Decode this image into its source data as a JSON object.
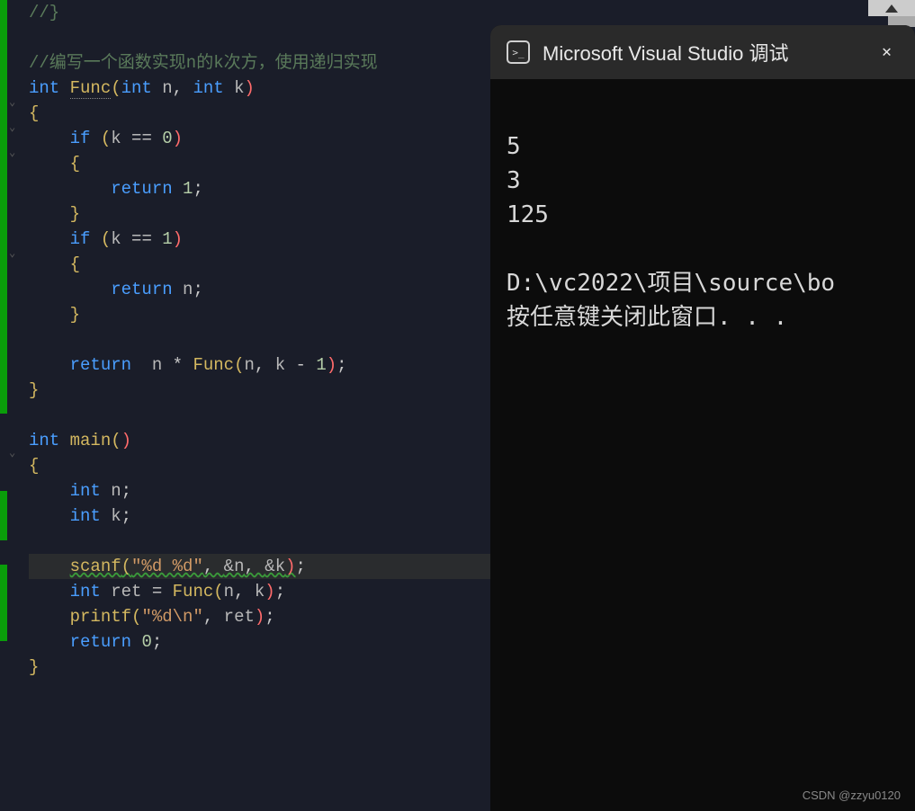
{
  "editor": {
    "lines": {
      "l0_brace": "//}",
      "comment": "//编写一个函数实现n的k次方，使用递归实现",
      "func_sig": {
        "kw_int": "int ",
        "name": "Func",
        "p1": "(",
        "arg1t": "int ",
        "arg1": "n",
        "comma1": ", ",
        "arg2t": "int ",
        "arg2": "k",
        "p2": ")"
      },
      "obrace": "{",
      "if_k0": {
        "kw": "if ",
        "p1": "(",
        "var": "k ",
        "op": "== ",
        "num": "0",
        "p2": ")"
      },
      "obrace2": "{",
      "ret1": {
        "kw": "return ",
        "num": "1",
        "semi": ";"
      },
      "cbrace2": "}",
      "if_k1": {
        "kw": "if ",
        "p1": "(",
        "var": "k ",
        "op": "== ",
        "num": "1",
        "p2": ")"
      },
      "obrace3": "{",
      "retn": {
        "kw": "return ",
        "var": "n",
        "semi": ";"
      },
      "cbrace3": "}",
      "ret_rec": {
        "kw": "return  ",
        "n": "n ",
        "star": "* ",
        "fn": "Func",
        "p1": "(",
        "a1": "n",
        "c": ", ",
        "a2": "k ",
        "minus": "- ",
        "one": "1",
        "p2": ")",
        "semi": ";"
      },
      "cbrace": "}",
      "main_sig": {
        "kw_int": "int ",
        "name": "main",
        "p1": "(",
        "p2": ")"
      },
      "mobrace": "{",
      "decl_n": {
        "kw": "int ",
        "v": "n",
        "semi": ";"
      },
      "decl_k": {
        "kw": "int ",
        "v": "k",
        "semi": ";"
      },
      "scanf": {
        "fn": "scanf",
        "p1": "(",
        "str": "\"%d %d\"",
        "c": ", ",
        "a1": "&n",
        "c2": ", ",
        "a2": "&k",
        "p2": ")",
        "semi": ";"
      },
      "call": {
        "kw": "int ",
        "v": "ret ",
        "eq": "= ",
        "fn": "Func",
        "p1": "(",
        "a1": "n",
        "c": ", ",
        "a2": "k",
        "p2": ")",
        "semi": ";"
      },
      "printf": {
        "fn": "printf",
        "p1": "(",
        "str": "\"%d\\n\"",
        "c": ", ",
        "a1": "ret",
        "p2": ")",
        "semi": ";"
      },
      "ret0": {
        "kw": "return ",
        "num": "0",
        "semi": ";"
      },
      "mcbrace": "}"
    }
  },
  "console": {
    "title": "Microsoft Visual Studio 调试",
    "output": {
      "line1": "5",
      "line2": "3",
      "line3": "125",
      "line4": "",
      "line5": "D:\\vc2022\\项目\\source\\bo",
      "line6": "按任意键关闭此窗口. . ."
    }
  },
  "watermark": "CSDN @zzyu0120"
}
